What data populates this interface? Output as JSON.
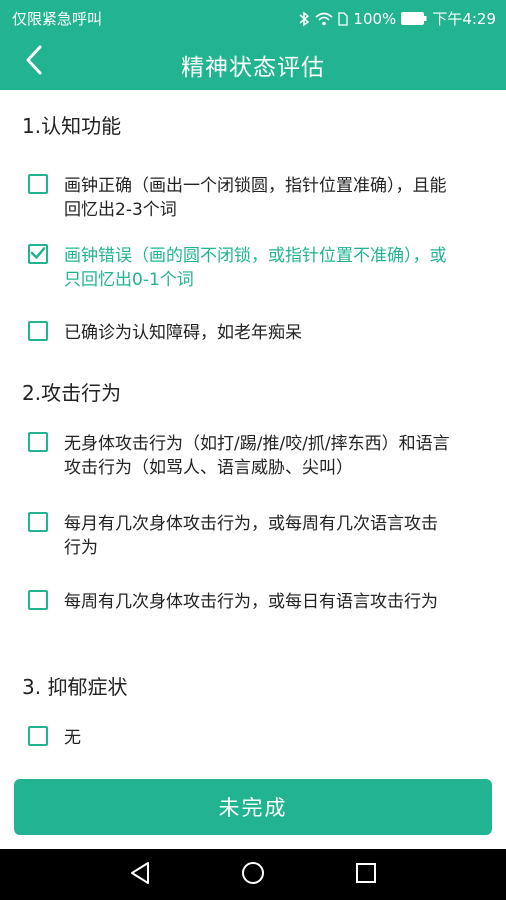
{
  "status_bar": {
    "carrier": "仅限紧急呼叫",
    "battery": "100%",
    "time": "下午4:29"
  },
  "header": {
    "title": "精神状态评估"
  },
  "sections": [
    {
      "title": "1.认知功能",
      "options": [
        {
          "text": "画钟正确（画出一个闭锁圆，指针位置准确），且能回忆出2-3个词",
          "checked": false
        },
        {
          "text": "画钟错误（画的圆不闭锁，或指针位置不准确），或只回忆出0-1个词",
          "checked": true
        },
        {
          "text": "已确诊为认知障碍，如老年痴呆",
          "checked": false
        }
      ]
    },
    {
      "title": "2.攻击行为",
      "options": [
        {
          "text": "无身体攻击行为（如打/踢/推/咬/抓/摔东西）和语言攻击行为（如骂人、语言威胁、尖叫）",
          "checked": false
        },
        {
          "text": "每月有几次身体攻击行为，或每周有几次语言攻击行为",
          "checked": false
        },
        {
          "text": "每周有几次身体攻击行为，或每日有语言攻击行为",
          "checked": false
        }
      ]
    },
    {
      "title": "3. 抑郁症状",
      "options": [
        {
          "text": "无",
          "checked": false
        }
      ]
    }
  ],
  "submit": {
    "label": "未完成"
  },
  "colors": {
    "accent": "#22b491",
    "nav_bar": "#000000"
  }
}
